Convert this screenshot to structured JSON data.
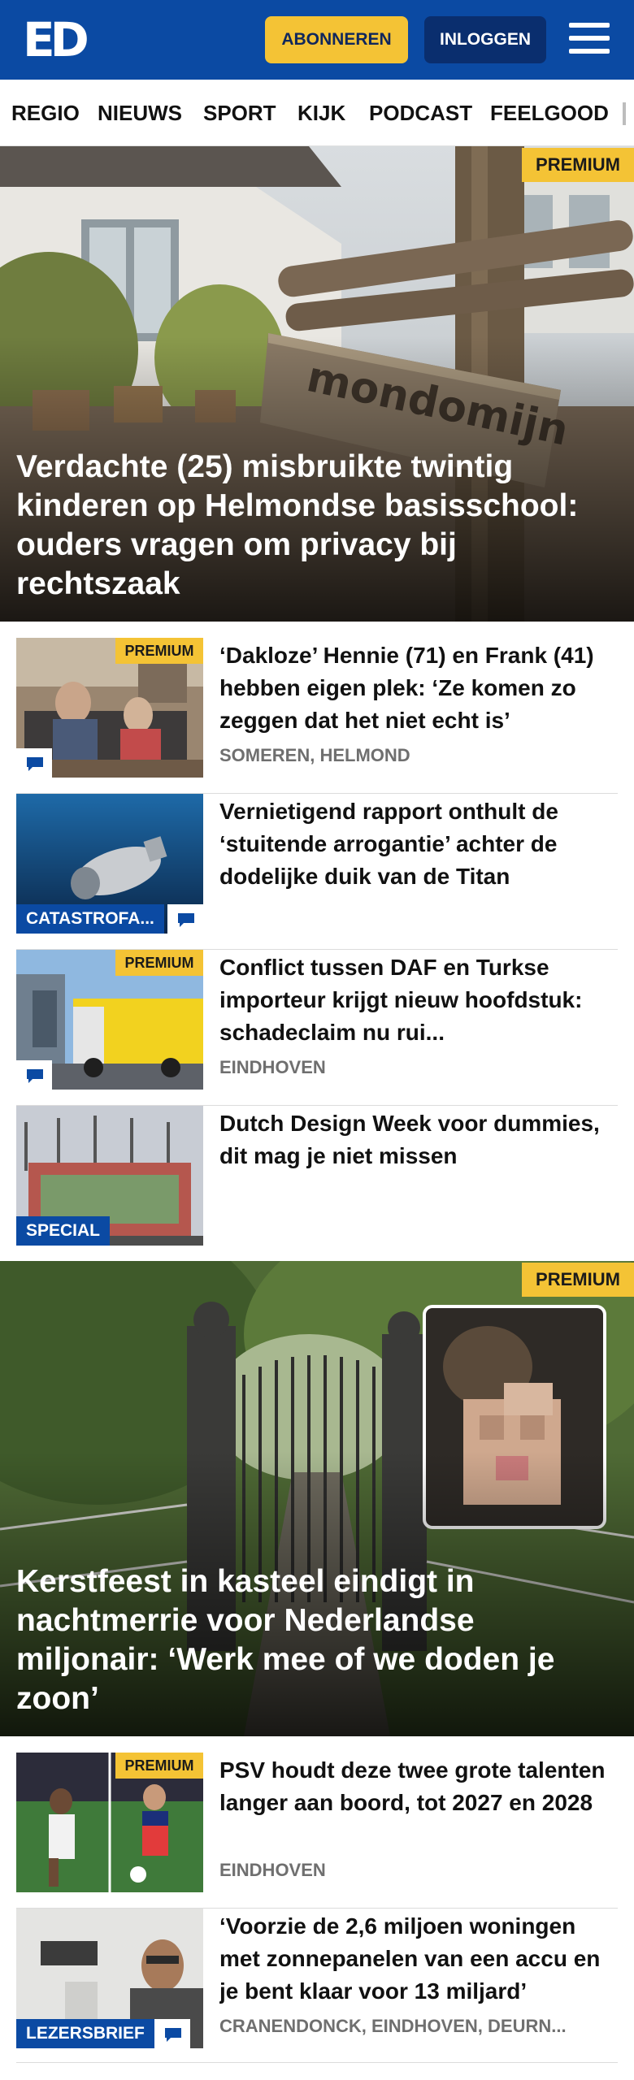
{
  "header": {
    "logo": "ED",
    "subscribe_label": "ABONNEREN",
    "login_label": "INLOGGEN"
  },
  "nav": {
    "items": [
      "REGIO",
      "NIEUWS",
      "SPORT",
      "KIJK",
      "PODCAST",
      "FEELGOOD"
    ]
  },
  "hero1": {
    "badge": "PREMIUM",
    "sign_text": "mondomijn",
    "title": "Verdachte (25) misbruikte twintig kinderen op Helmondse basisschool: ouders vragen om privacy bij rechtszaak"
  },
  "articles1": [
    {
      "badge": "PREMIUM",
      "title": "‘Dakloze’ Hennie (71) en Frank (41) hebben eigen plek: ‘Ze komen zo zeggen dat het niet echt is’",
      "meta": "SOMEREN, HELMOND",
      "label": "",
      "comments": true
    },
    {
      "badge": "",
      "title": "Vernietigend rapport onthult de ‘stuitende arrogantie’ achter de dodelijke duik van de Titan",
      "meta": "",
      "label": "CATASTROFA...",
      "comments": true
    },
    {
      "badge": "PREMIUM",
      "title": "Conflict tussen DAF en Turkse importeur krijgt nieuw hoofdstuk: schadeclaim nu rui...",
      "meta": "EINDHOVEN",
      "label": "",
      "comments": true
    },
    {
      "badge": "",
      "title": "Dutch Design Week voor dummies, dit mag je niet missen",
      "meta": "",
      "label": "SPECIAL",
      "comments": false
    }
  ],
  "hero2": {
    "badge": "PREMIUM",
    "title": "Kerstfeest in kasteel eindigt in nachtmerrie voor Nederlandse miljonair: ‘Werk mee of we doden je zoon’"
  },
  "articles2": [
    {
      "badge": "PREMIUM",
      "title": "PSV houdt deze twee grote talenten langer aan boord, tot 2027 en 2028",
      "meta": "EINDHOVEN",
      "label": "",
      "comments": false
    },
    {
      "badge": "",
      "title": "‘Voorzie de 2,6 miljoen woningen met zonnepanelen van een accu en je bent klaar voor 13 miljard’",
      "meta": "CRANENDONCK, EINDHOVEN, DEURN...",
      "label": "LEZERSBRIEF",
      "comments": true
    }
  ],
  "icons": {
    "menu": "hamburger-menu-icon",
    "comment": "comment-bubble-icon"
  },
  "colors": {
    "brand_blue": "#0b4aa3",
    "premium_yellow": "#f4c335",
    "login_navy": "#0a2e6e",
    "meta_gray": "#6f6f6f"
  }
}
